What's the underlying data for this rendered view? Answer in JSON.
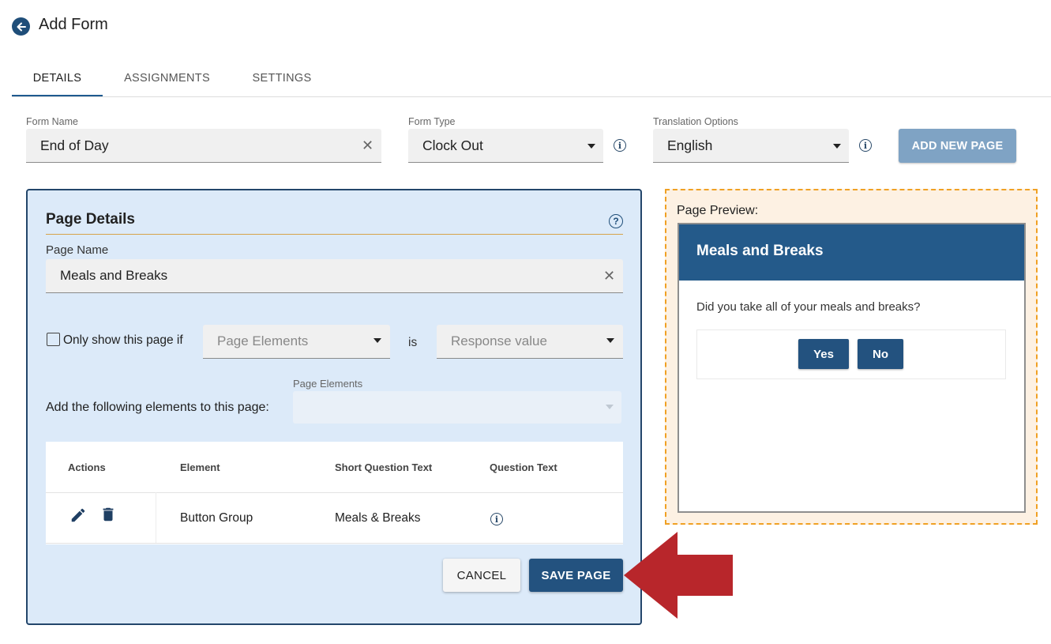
{
  "header": {
    "title": "Add Form"
  },
  "tabs": [
    {
      "label": "DETAILS",
      "active": true
    },
    {
      "label": "ASSIGNMENTS",
      "active": false
    },
    {
      "label": "SETTINGS",
      "active": false
    }
  ],
  "form": {
    "form_name": {
      "label": "Form Name",
      "value": "End of Day"
    },
    "form_type": {
      "label": "Form Type",
      "value": "Clock Out"
    },
    "translation": {
      "label": "Translation Options",
      "value": "English"
    },
    "add_page_label": "ADD NEW PAGE"
  },
  "page_details": {
    "title": "Page Details",
    "page_name": {
      "label": "Page Name",
      "value": "Meals and Breaks"
    },
    "condition": {
      "checkbox_label": "Only show this page if",
      "checked": false,
      "element_placeholder": "Page Elements",
      "is_label": "is",
      "response_placeholder": "Response value"
    },
    "add_elements": {
      "text": "Add the following elements to this page:",
      "select_label": "Page Elements"
    },
    "table": {
      "headers": [
        "Actions",
        "Element",
        "Short Question Text",
        "Question Text"
      ],
      "rows": [
        {
          "element": "Button Group",
          "short_text": "Meals & Breaks"
        }
      ]
    },
    "cancel_label": "CANCEL",
    "save_label": "SAVE PAGE"
  },
  "preview": {
    "label": "Page Preview:",
    "header": "Meals and Breaks",
    "question": "Did you take all of your meals and breaks?",
    "buttons": [
      "Yes",
      "No"
    ]
  },
  "colors": {
    "primary": "#23527f",
    "panel_bg": "#dceaf9",
    "preview_border": "#f0a124",
    "arrow": "#b8262b"
  },
  "icons": [
    "arrow-left-icon",
    "clear-icon",
    "chevron-down-icon",
    "info-icon",
    "help-icon",
    "pencil-icon",
    "trash-icon",
    "red-arrow-icon"
  ]
}
